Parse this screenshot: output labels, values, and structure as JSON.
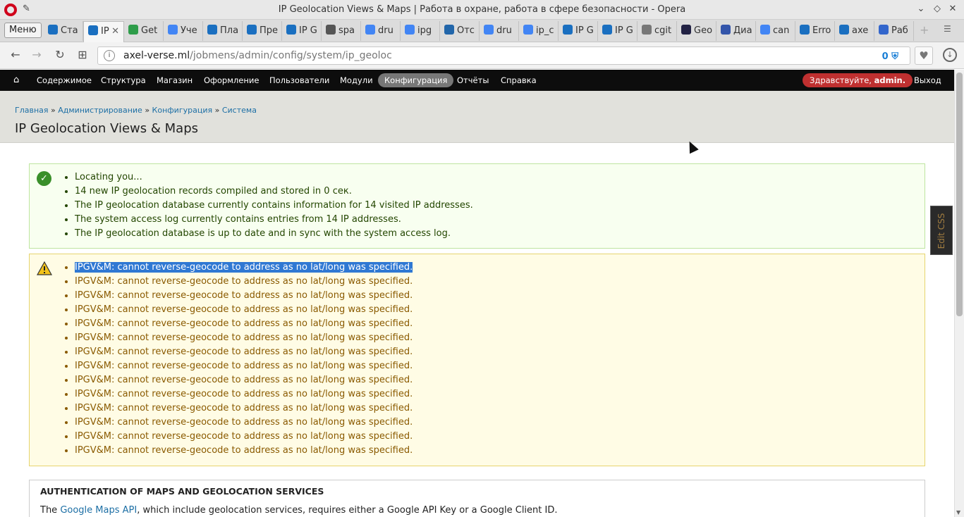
{
  "window": {
    "title": "IP Geolocation Views & Maps | Работа в охране, работа в сфере безопасности - Opera"
  },
  "browser": {
    "menu_label": "Меню",
    "tabs": [
      {
        "label": "Ста",
        "color": "#1a6fc0"
      },
      {
        "label": "IP",
        "color": "#1a6fc0",
        "active": true
      },
      {
        "label": "Get",
        "color": "#2e9d4a"
      },
      {
        "label": "Уче",
        "color": "#4285f4"
      },
      {
        "label": "Пла",
        "color": "#1a6fc0"
      },
      {
        "label": "Пре",
        "color": "#1a6fc0"
      },
      {
        "label": "IP G",
        "color": "#1a6fc0"
      },
      {
        "label": "spa",
        "color": "#555555"
      },
      {
        "label": "dru",
        "color": "#4285f4"
      },
      {
        "label": "ipg",
        "color": "#4285f4"
      },
      {
        "label": "Отс",
        "color": "#2266aa"
      },
      {
        "label": "dru",
        "color": "#4285f4"
      },
      {
        "label": "ip_c",
        "color": "#4285f4"
      },
      {
        "label": "IP G",
        "color": "#1a6fc0"
      },
      {
        "label": "IP G",
        "color": "#1a6fc0"
      },
      {
        "label": "cgit",
        "color": "#777777"
      },
      {
        "label": "Geo",
        "color": "#222244"
      },
      {
        "label": "Диа",
        "color": "#3355aa"
      },
      {
        "label": "can",
        "color": "#4285f4"
      },
      {
        "label": "Erro",
        "color": "#1a6fc0"
      },
      {
        "label": "axe",
        "color": "#1a6fc0"
      },
      {
        "label": "Раб",
        "color": "#3366cc"
      }
    ],
    "url_host": "axel-verse.ml",
    "url_path": "/jobmens/admin/config/system/ip_geoloc",
    "shield_count": "0"
  },
  "toolbar": {
    "items": [
      "Содержимое",
      "Структура",
      "Магазин",
      "Оформление",
      "Пользователи",
      "Модули",
      "Конфигурация",
      "Отчёты",
      "Справка"
    ],
    "hello_prefix": "Здравствуйте,",
    "hello_user": "admin.",
    "logout": "Выход"
  },
  "breadcrumb": {
    "items": [
      "Главная",
      "Администрирование",
      "Конфигурация",
      "Система"
    ],
    "separator": "»"
  },
  "page_title": "IP Geolocation Views & Maps",
  "status_messages": [
    "Locating you...",
    "14 new IP geolocation records compiled and stored in 0 сек.",
    "The IP geolocation database currently contains information for 14 visited IP addresses.",
    "The system access log currently contains entries from 14 IP addresses.",
    "The IP geolocation database is up to date and in sync with the system access log."
  ],
  "warning_messages": [
    "IPGV&M: cannot reverse-geocode to address as no lat/long was specified.",
    "IPGV&M: cannot reverse-geocode to address as no lat/long was specified.",
    "IPGV&M: cannot reverse-geocode to address as no lat/long was specified.",
    "IPGV&M: cannot reverse-geocode to address as no lat/long was specified.",
    "IPGV&M: cannot reverse-geocode to address as no lat/long was specified.",
    "IPGV&M: cannot reverse-geocode to address as no lat/long was specified.",
    "IPGV&M: cannot reverse-geocode to address as no lat/long was specified.",
    "IPGV&M: cannot reverse-geocode to address as no lat/long was specified.",
    "IPGV&M: cannot reverse-geocode to address as no lat/long was specified.",
    "IPGV&M: cannot reverse-geocode to address as no lat/long was specified.",
    "IPGV&M: cannot reverse-geocode to address as no lat/long was specified.",
    "IPGV&M: cannot reverse-geocode to address as no lat/long was specified.",
    "IPGV&M: cannot reverse-geocode to address as no lat/long was specified.",
    "IPGV&M: cannot reverse-geocode to address as no lat/long was specified."
  ],
  "auth_section": {
    "title": "AUTHENTICATION OF MAPS AND GEOLOCATION SERVICES",
    "text_before": "The ",
    "link": "Google Maps API",
    "text_after": ", which include geolocation services, requires either a Google API Key or a Google Client ID."
  },
  "edit_css_label": "Edit CSS",
  "colors": {
    "toolbar_bg": "#0d0d0d",
    "hello_bg": "#bf3030",
    "ok_bg": "#f8fff0",
    "warn_bg": "#fffce5",
    "link": "#1d6fa5"
  }
}
